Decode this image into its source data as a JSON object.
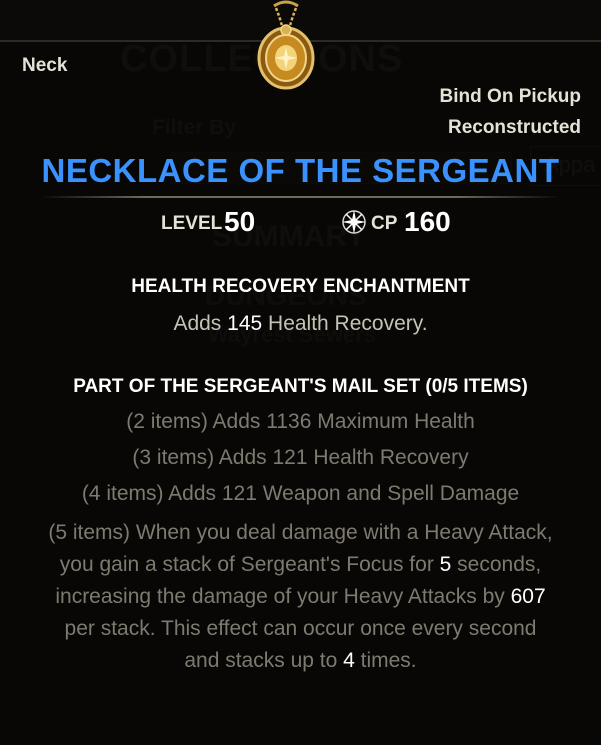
{
  "background": {
    "collections_title": "COLLECTIONS",
    "filter_label": "Filter By",
    "apparel_button": "Appa",
    "summary_label": "SUMMARY",
    "dungeons_label": "DUNGEONS",
    "wayrest_label": "Wayrest Sewers"
  },
  "tooltip": {
    "slot": "Neck",
    "bind": "Bind On Pickup",
    "state": "Reconstructed",
    "item_name": "NECKLACE OF THE SERGEANT",
    "item_name_color": "#3a92ff",
    "level_label": "LEVEL",
    "level_value": "50",
    "cp_icon": "champion-point-icon",
    "cp_label": "CP",
    "cp_value": "160",
    "enchantment": {
      "title": "HEALTH RECOVERY ENCHANTMENT",
      "desc_prefix": "Adds ",
      "desc_value": "145",
      "desc_suffix": " Health Recovery."
    },
    "set": {
      "title": "PART OF THE SERGEANT'S MAIL SET (0/5 ITEMS)",
      "bonus_2": "(2 items) Adds 1136 Maximum Health",
      "bonus_3": "(3 items) Adds 121 Health Recovery",
      "bonus_4": "(4 items) Adds 121 Weapon and Spell Damage",
      "bonus_5_a": "(5 items) When you deal damage with a Heavy Attack,",
      "bonus_5_b": "you gain a stack of Sergeant's Focus for ",
      "bonus_5_b_val": "5",
      "bonus_5_b_end": " seconds,",
      "bonus_5_c": "increasing the damage of your Heavy Attacks by ",
      "bonus_5_c_val": "607",
      "bonus_5_d": "per stack. This effect can occur once every second",
      "bonus_5_e": "and stacks up to ",
      "bonus_5_e_val": "4",
      "bonus_5_e_end": " times."
    }
  }
}
